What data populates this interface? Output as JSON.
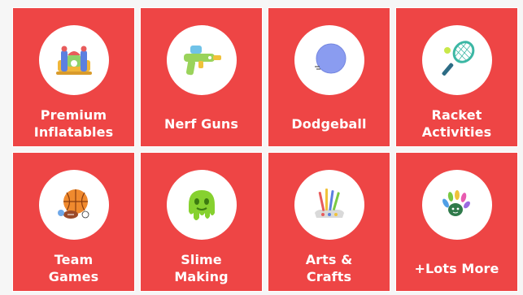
{
  "activities": [
    {
      "label": "Premium\nInflatables",
      "icon": "bounce-house-icon"
    },
    {
      "label": "Nerf Guns",
      "icon": "water-blaster-icon"
    },
    {
      "label": "Dodgeball",
      "icon": "dodgeball-icon"
    },
    {
      "label": "Racket\nActivities",
      "icon": "tennis-racket-icon"
    },
    {
      "label": "Team\nGames",
      "icon": "sports-balls-icon"
    },
    {
      "label": "Slime\nMaking",
      "icon": "slime-icon"
    },
    {
      "label": "Arts &\nCrafts",
      "icon": "paintbrushes-icon"
    },
    {
      "label": "+Lots More",
      "icon": "hand-print-icon"
    }
  ],
  "colors": {
    "card_background": "#ee4545",
    "circle_background": "#ffffff",
    "label_color": "#ffffff"
  }
}
